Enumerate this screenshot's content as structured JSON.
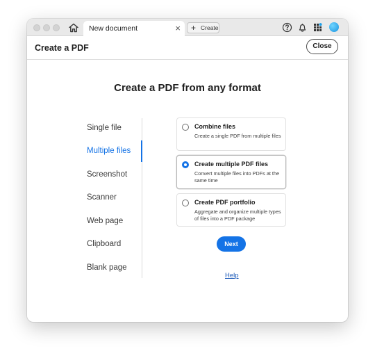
{
  "titlebar": {
    "tab_label": "New document",
    "tab_close": "×",
    "create_label": "Create",
    "create_plus": "+"
  },
  "header": {
    "title": "Create a PDF",
    "close_label": "Close"
  },
  "main": {
    "title": "Create a PDF from any format"
  },
  "nav": {
    "items": [
      {
        "label": "Single file"
      },
      {
        "label": "Multiple files",
        "active": true
      },
      {
        "label": "Screenshot"
      },
      {
        "label": "Scanner"
      },
      {
        "label": "Web page"
      },
      {
        "label": "Clipboard"
      },
      {
        "label": "Blank page"
      }
    ]
  },
  "options": [
    {
      "title": "Combine files",
      "description": "Create a single PDF from multiple files",
      "selected": false
    },
    {
      "title": "Create multiple PDF files",
      "description": "Convert multiple files into PDFs at the same time",
      "selected": true
    },
    {
      "title": "Create PDF portfolio",
      "description": "Aggregate and organize multiple types of files into a PDF package",
      "selected": false
    }
  ],
  "actions": {
    "next_label": "Next",
    "help_label": "Help"
  },
  "icons": {
    "home": "home-icon",
    "help": "help-circle-icon",
    "bell": "bell-icon",
    "apps": "apps-grid-icon",
    "avatar": "avatar"
  },
  "colors": {
    "accent": "#1473e6",
    "link": "#1a58b8"
  }
}
